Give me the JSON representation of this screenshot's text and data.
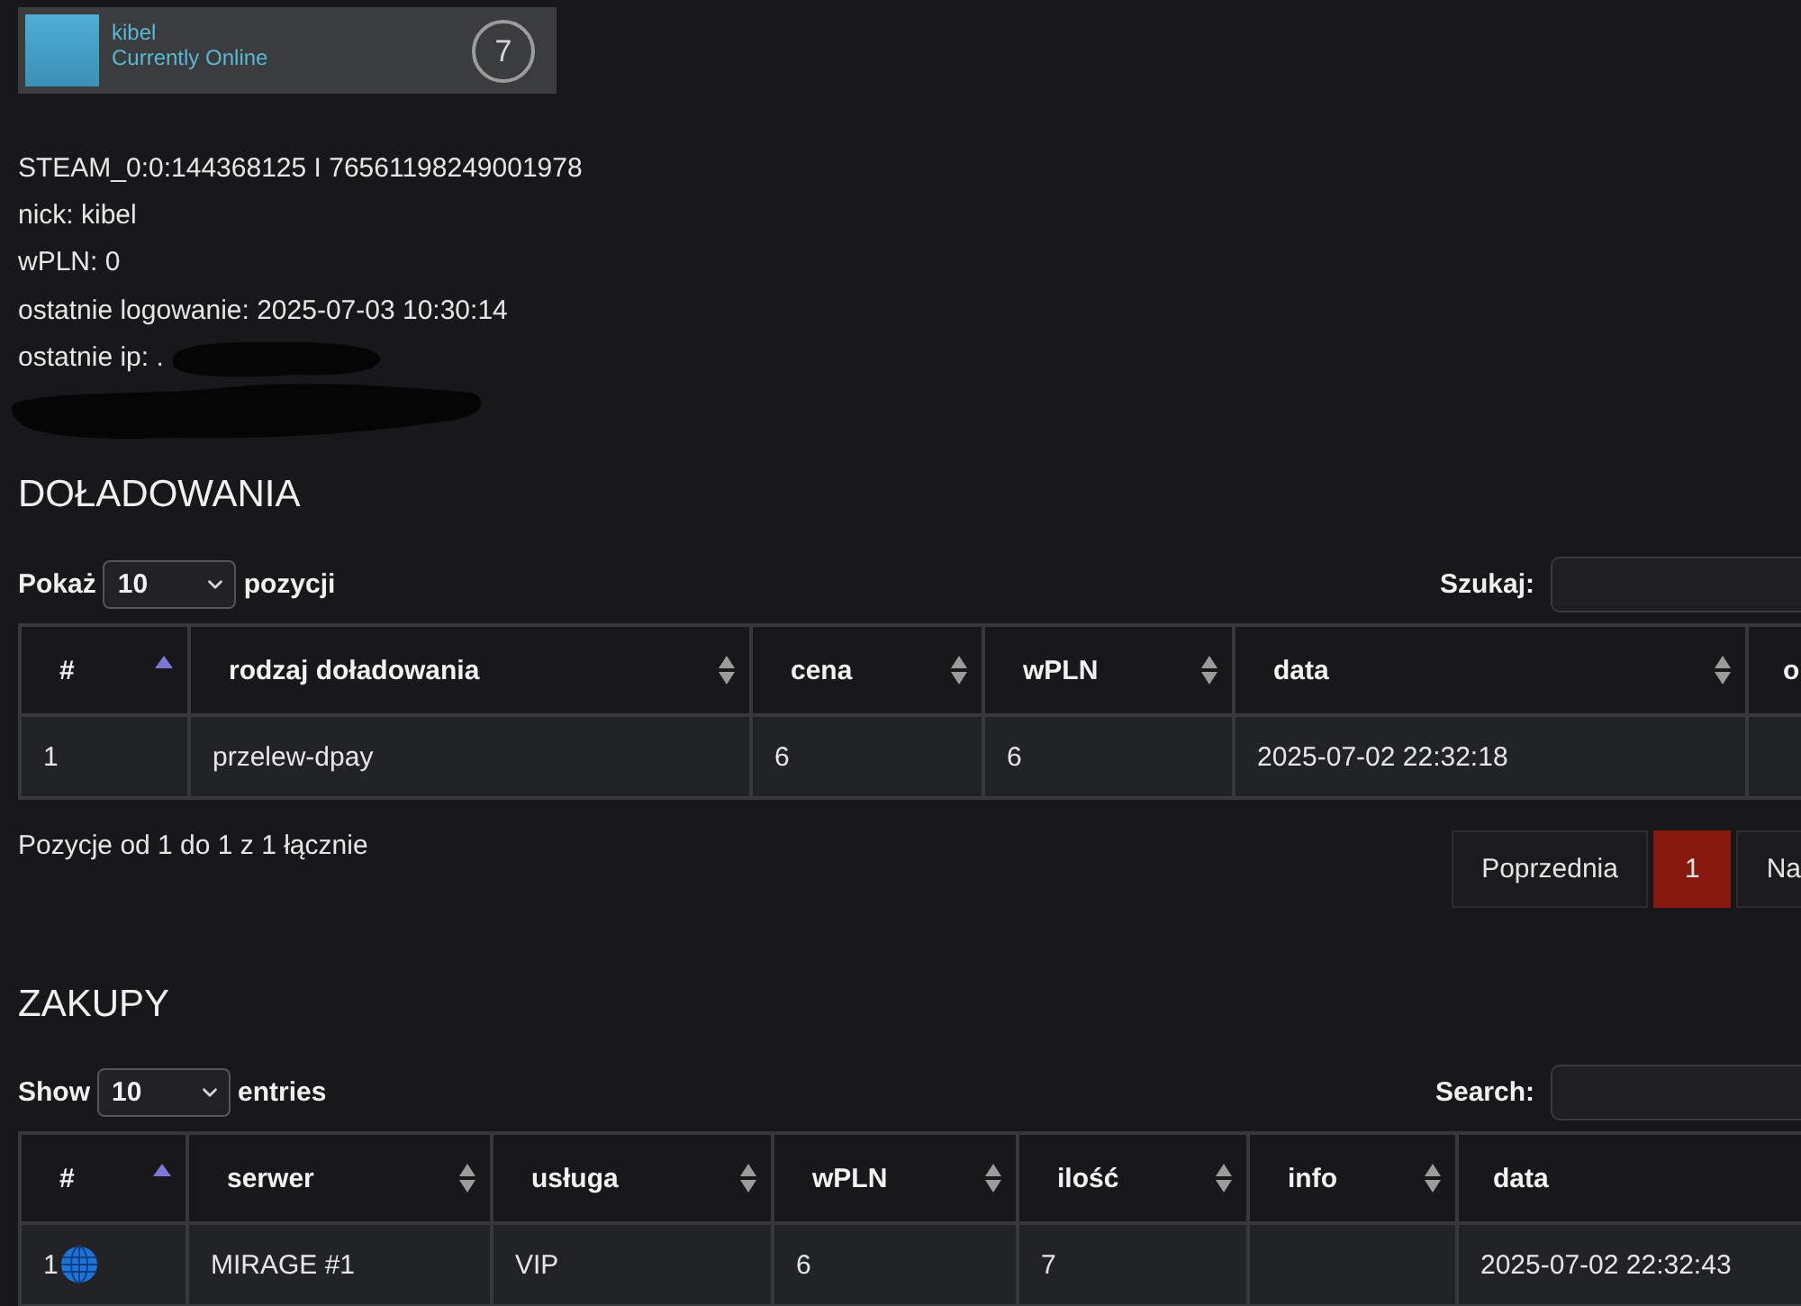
{
  "profile_card": {
    "name": "kibel",
    "status": "Currently Online",
    "online": true,
    "level_badge": "7"
  },
  "info_lines": [
    {
      "text": "STEAM_0:0:144368125 I 76561198249001978",
      "redacted": false
    },
    {
      "text": "nick: kibel",
      "redacted": false
    },
    {
      "text": "wPLN: 0",
      "redacted": false
    },
    {
      "text": "ostatnie logowanie: 2025-07-03 10:30:14",
      "redacted": false
    },
    {
      "text": "ostatnie ip: .",
      "redacted": true
    },
    {
      "redacted": true
    }
  ],
  "sections": [
    {
      "title": "DOŁADOWANIA",
      "length_label_before": "Pokaż",
      "length_value": "10",
      "length_label_after": "pozycji",
      "search_label": "Szukaj:",
      "columns": [
        {
          "label": "#",
          "sorted": true
        },
        {
          "label": "rodzaj doładowania",
          "sorted": false
        },
        {
          "label": "cena",
          "sorted": false
        },
        {
          "label": "wPLN",
          "sorted": false
        },
        {
          "label": "data",
          "sorted": false
        },
        {
          "label": "o"
        }
      ],
      "rows": [
        {
          "cells": [
            "1",
            "przelew-dpay",
            "6",
            "6",
            "2025-07-02 22:32:18",
            null
          ]
        }
      ],
      "summary": "Pozycje od 1 do 1 z 1 łącznie",
      "pagination": [
        {
          "label": "Poprzednia",
          "selected": false
        },
        {
          "label": "1",
          "selected": true
        },
        {
          "label": "Na",
          "selected": false
        }
      ]
    },
    {
      "title": "ZAKUPY",
      "length_label_before": "Show",
      "length_value": "10",
      "length_label_after": "entries",
      "search_label": "Search:",
      "columns": [
        {
          "label": "#",
          "sorted": true
        },
        {
          "label": "serwer",
          "sorted": false
        },
        {
          "label": "usługa",
          "sorted": false
        },
        {
          "label": "wPLN",
          "sorted": false
        },
        {
          "label": "ilość",
          "sorted": false
        },
        {
          "label": "info",
          "sorted": false
        },
        {
          "label": "data"
        }
      ],
      "rows": [
        {
          "cells": [
            "1",
            "MIRAGE #1",
            "VIP",
            "6",
            "7",
            null,
            "2025-07-02 22:32:43"
          ],
          "web_purchase": true
        }
      ]
    }
  ]
}
